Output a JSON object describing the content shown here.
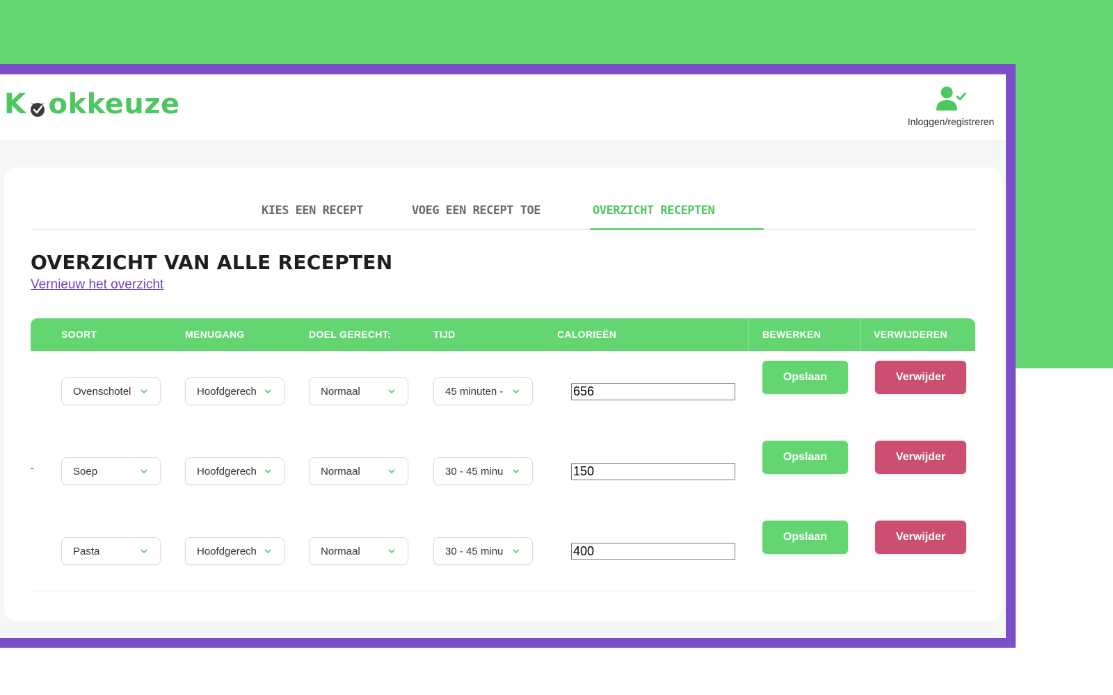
{
  "app": {
    "logo": "Kookkeuze",
    "logo_pre": "K",
    "logo_post": "okkeuze"
  },
  "user": {
    "label": "Inloggen/registreren"
  },
  "tabs": [
    {
      "label": "KIES EEN RECEPT"
    },
    {
      "label": "VOEG EEN RECEPT TOE"
    },
    {
      "label": "OVERZICHT RECEPTEN"
    }
  ],
  "page": {
    "title": "OVERZICHT VAN ALLE RECEPTEN",
    "refresh_link": "Vernieuw het overzicht"
  },
  "table": {
    "headers": [
      "SOORT",
      "MENUGANG",
      "DOEL GERECHT:",
      "TIJD",
      "CALORIEËN",
      "BEWERKEN",
      "VERWIJDEREN"
    ],
    "rows": [
      {
        "soort": "Ovenschotel",
        "menugang": "Hoofdgerech",
        "doel": "Normaal",
        "tijd": "45 minuten -",
        "calorieen": "656",
        "save": "Opslaan",
        "delete": "Verwijder",
        "prefix": ""
      },
      {
        "soort": "Soep",
        "menugang": "Hoofdgerech",
        "doel": "Normaal",
        "tijd": "30 - 45 minu",
        "calorieen": "150",
        "save": "Opslaan",
        "delete": "Verwijder",
        "prefix": "-"
      },
      {
        "soort": "Pasta",
        "menugang": "Hoofdgerech",
        "doel": "Normaal",
        "tijd": "30 - 45 minu",
        "calorieen": "400",
        "save": "Opslaan",
        "delete": "Verwijder",
        "prefix": ""
      }
    ]
  },
  "colors": {
    "green": "#63d672",
    "purple": "#7b4fc9",
    "delete_red": "#cb4f6e",
    "link_purple": "#6a45c4"
  }
}
